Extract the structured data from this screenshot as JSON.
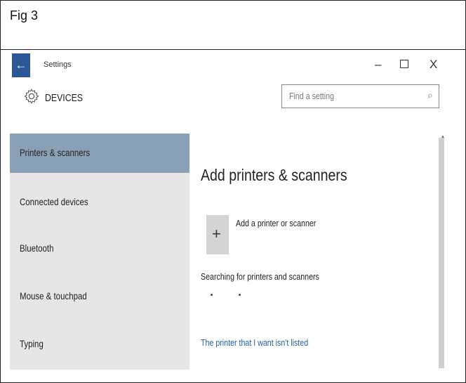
{
  "figure": {
    "label": "Fig 3"
  },
  "window": {
    "back_icon": "back-arrow-icon",
    "back_glyph": "←",
    "title": "Settings",
    "minimize_glyph": "–",
    "close_glyph": "X"
  },
  "header": {
    "icon": "gear-icon",
    "title": "DEVICES",
    "search_placeholder": "Find a setting",
    "search_icon": "search-icon",
    "search_glyph": "⌕"
  },
  "sidebar": {
    "items": [
      {
        "label": "Printers & scanners",
        "active": true
      },
      {
        "label": "Connected devices",
        "active": false
      },
      {
        "label": "Bluetooth",
        "active": false
      },
      {
        "label": "Mouse & touchpad",
        "active": false
      },
      {
        "label": "Typing",
        "active": false
      }
    ]
  },
  "main": {
    "heading": "Add printers & scanners",
    "add_glyph": "+",
    "add_label": "Add a printer or scanner",
    "status": "Searching for printers and scanners",
    "link": "The printer that I want isn't listed"
  },
  "colors": {
    "accent": "#2b5797",
    "sidebar_bg": "#e6e6e6",
    "sidebar_active": "#8aa0b6",
    "link": "#1f5fa5"
  }
}
